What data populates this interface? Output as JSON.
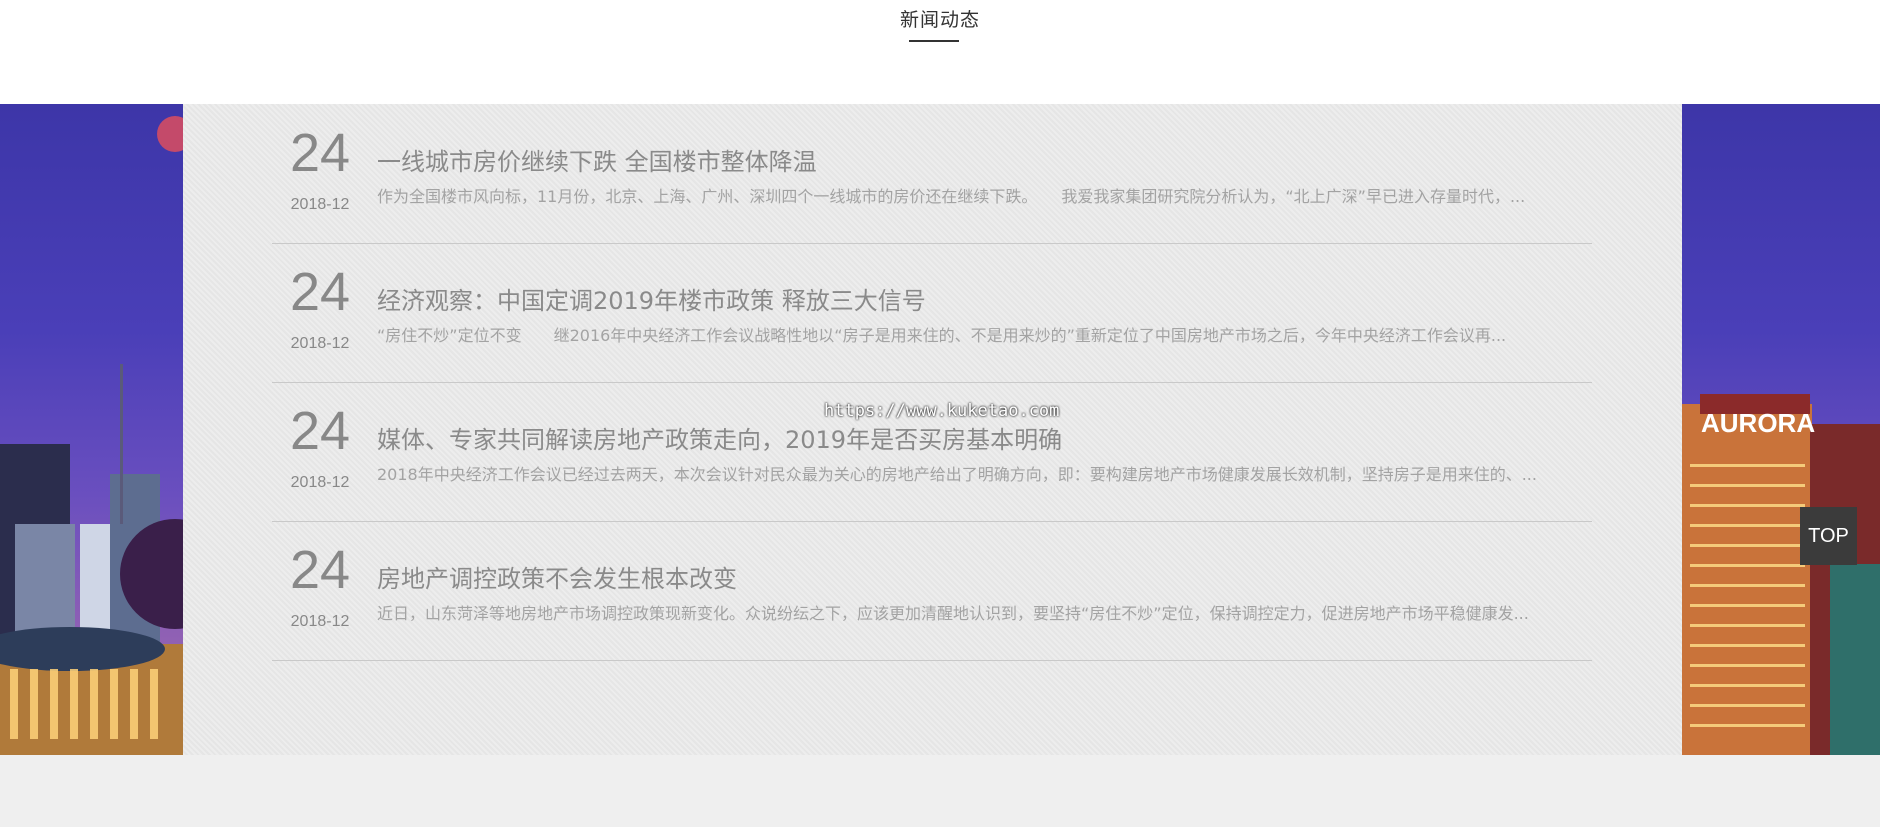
{
  "section": {
    "title": "新闻动态"
  },
  "brand": {
    "building_sign": "AURORA"
  },
  "news": [
    {
      "day": "24",
      "year_month": "2018-12",
      "title": "一线城市房价继续下跌 全国楼市整体降温",
      "summary": "作为全国楼市风向标，11月份，北京、上海、广州、深圳四个一线城市的房价还在继续下跌。　　我爱我家集团研究院分析认为，“北上广深”早已进入存量时代，..."
    },
    {
      "day": "24",
      "year_month": "2018-12",
      "title": "经济观察：中国定调2019年楼市政策 释放三大信号",
      "summary": "“房住不炒”定位不变　　继2016年中央经济工作会议战略性地以“房子是用来住的、不是用来炒的”重新定位了中国房地产市场之后，今年中央经济工作会议再..."
    },
    {
      "day": "24",
      "year_month": "2018-12",
      "title": "媒体、专家共同解读房地产政策走向，2019年是否买房基本明确",
      "summary": "2018年中央经济工作会议已经过去两天，本次会议针对民众最为关心的房地产给出了明确方向，即：要构建房地产市场健康发展长效机制，坚持房子是用来住的、..."
    },
    {
      "day": "24",
      "year_month": "2018-12",
      "title": "房地产调控政策不会发生根本改变",
      "summary": "近日，山东菏泽等地房地产市场调控政策现新变化。众说纷纭之下，应该更加清醒地认识到，要坚持“房住不炒”定位，保持调控定力，促进房地产市场平稳健康发..."
    }
  ],
  "watermark": "https://www.kuketao.com",
  "top_button": {
    "label": "TOP"
  },
  "colors": {
    "panel_bg": "#e9e9e9",
    "text_muted": "#8a8a8a",
    "top_button_bg": "#3b3b3b",
    "sky_top": "#3d36a8"
  }
}
